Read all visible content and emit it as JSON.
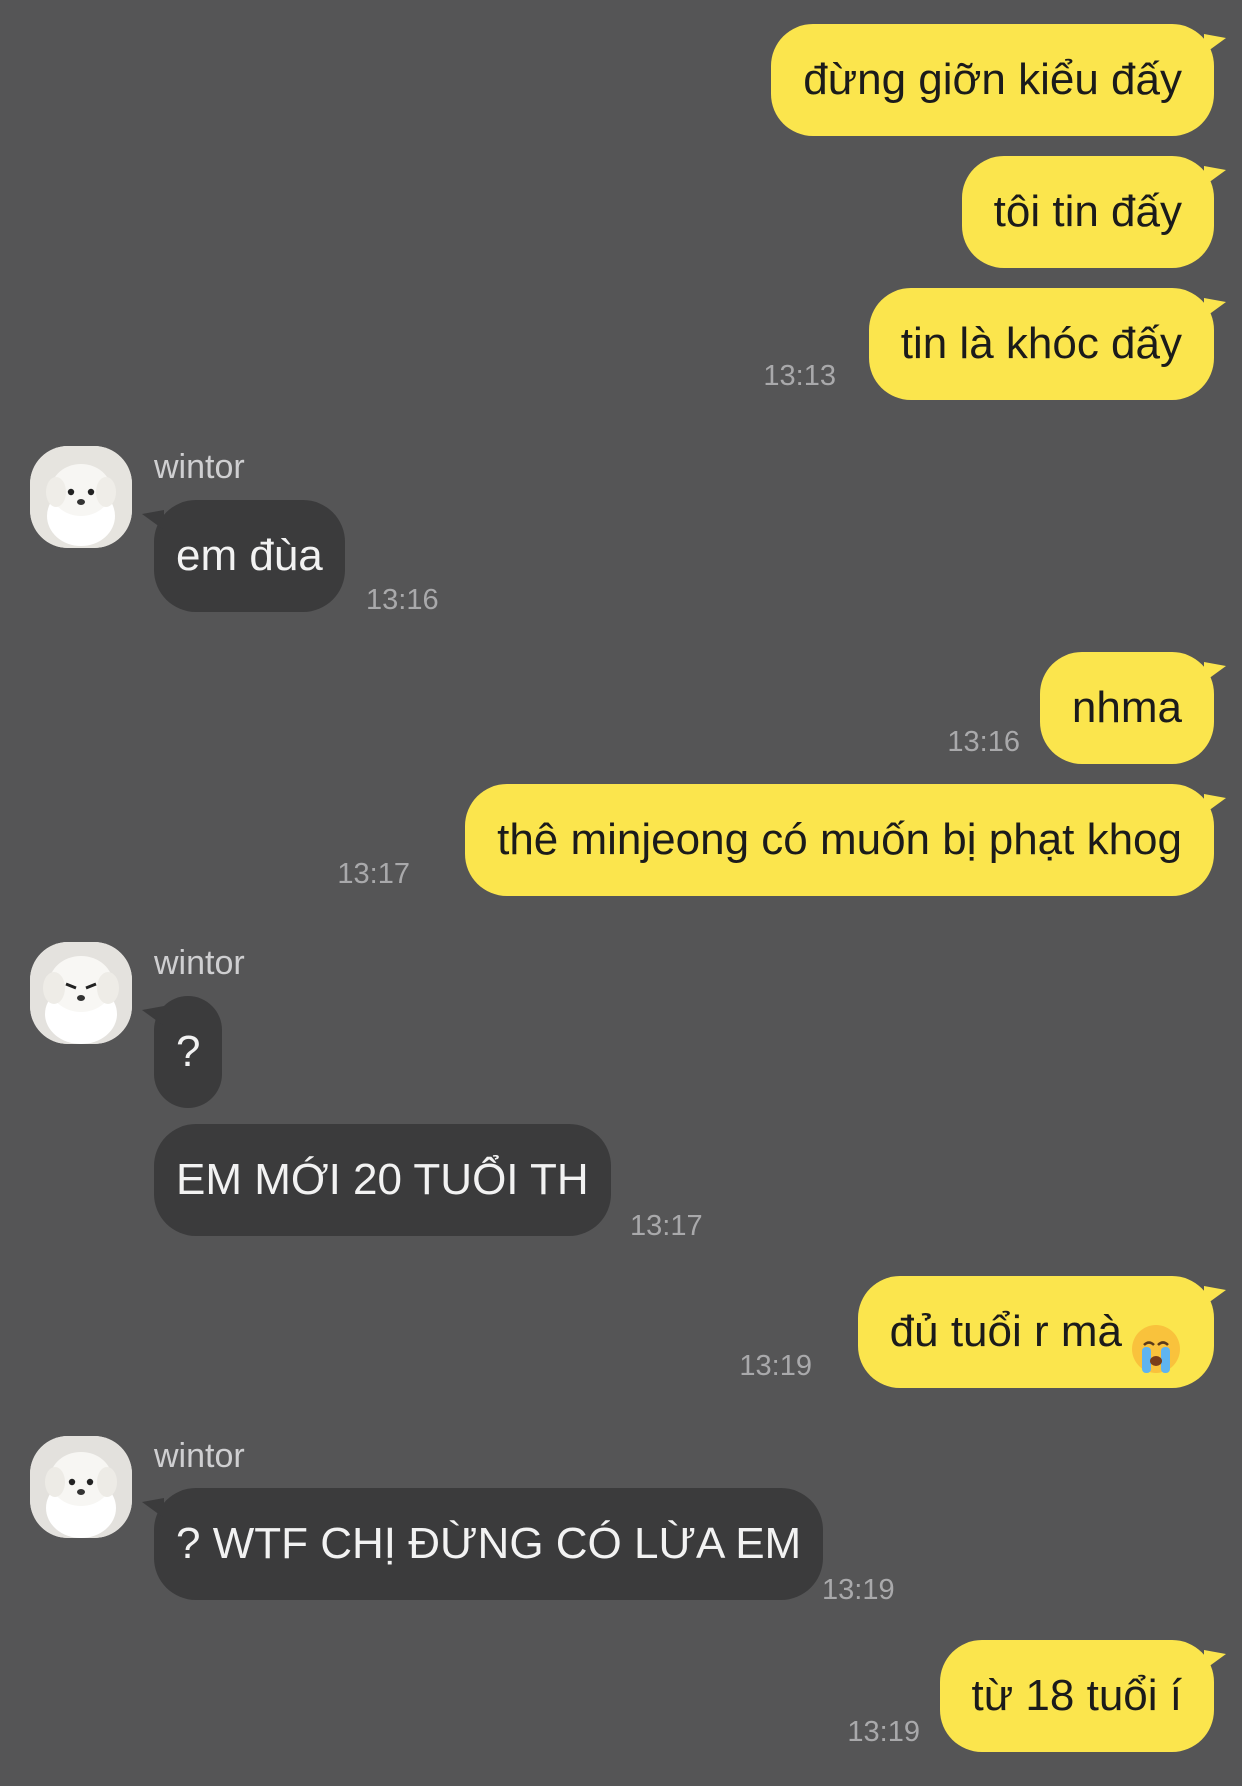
{
  "messages": [
    {
      "text": "đừng giỡn kiểu đấy"
    },
    {
      "text": "tôi tin đấy"
    },
    {
      "text": "tin là khóc đấy",
      "time": "13:13"
    },
    {
      "sender": "wintor",
      "text": "em đùa",
      "time": "13:16",
      "avatar": "puppy-avatar"
    },
    {
      "text": "nhma",
      "time": "13:16"
    },
    {
      "text": "thê minjeong có muốn bị phạt khog",
      "time": "13:17"
    },
    {
      "sender": "wintor",
      "text": "?",
      "avatar": "puppy-avatar"
    },
    {
      "text": "EM MỚI 20 TUỔI TH",
      "time": "13:17"
    },
    {
      "text": "đủ tuổi r mà",
      "emoji": "crying-face-emoji",
      "time": "13:19"
    },
    {
      "sender": "wintor",
      "text": "? WTF CHỊ ĐỪNG CÓ LỪA EM",
      "time": "13:19",
      "avatar": "puppy-avatar"
    },
    {
      "text": "từ 18 tuổi í",
      "time": "13:19"
    }
  ],
  "colors": {
    "background": "#555556",
    "outgoing_bubble": "#fbe54d",
    "incoming_bubble": "#3b3b3c",
    "timestamp": "#a9a9ab"
  }
}
